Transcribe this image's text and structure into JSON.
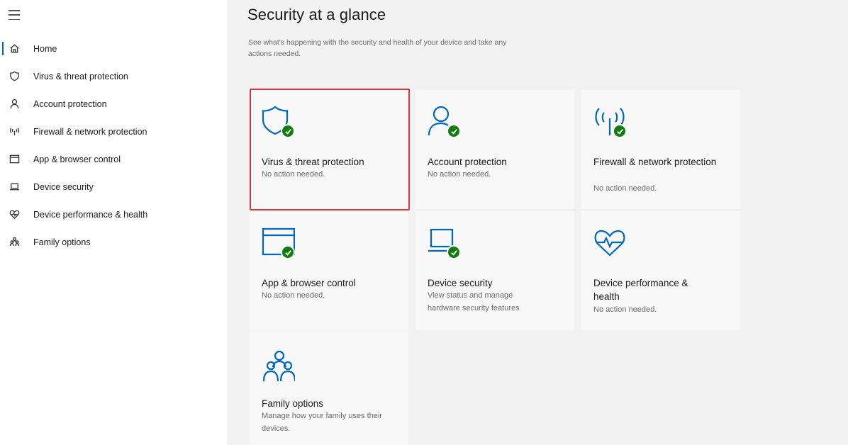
{
  "sidebar": {
    "items": [
      {
        "label": "Home",
        "icon": "home-icon",
        "active": true
      },
      {
        "label": "Virus & threat protection",
        "icon": "shield-icon"
      },
      {
        "label": "Account protection",
        "icon": "person-icon"
      },
      {
        "label": "Firewall & network protection",
        "icon": "wifi-antenna-icon"
      },
      {
        "label": "App & browser control",
        "icon": "browser-window-icon"
      },
      {
        "label": "Device security",
        "icon": "laptop-icon"
      },
      {
        "label": "Device performance & health",
        "icon": "heart-pulse-icon"
      },
      {
        "label": "Family options",
        "icon": "family-icon"
      }
    ]
  },
  "main": {
    "title": "Security at a glance",
    "subtitle": "See what's happening with the security and health of your device and take any actions needed.",
    "tiles": [
      {
        "title": "Virus & threat protection",
        "status": "No action needed.",
        "icon": "shield-icon",
        "selected": true
      },
      {
        "title": "Account protection",
        "status": "No action needed.",
        "icon": "person-icon"
      },
      {
        "title": "Firewall & network protection",
        "status": "No action needed.",
        "icon": "wifi-antenna-icon"
      },
      {
        "title": "App & browser control",
        "status": "No action needed.",
        "icon": "browser-window-icon"
      },
      {
        "title": "Device security",
        "status": "View status and manage hardware security features",
        "icon": "laptop-icon"
      },
      {
        "title": "Device performance & health",
        "status": "No action needed.",
        "icon": "heart-pulse-icon"
      },
      {
        "title": "Family options",
        "status": "Manage how your family uses their devices.",
        "icon": "family-icon"
      }
    ]
  },
  "colors": {
    "accent": "#0067c0",
    "ok_green": "#107c10",
    "highlight_red": "#e0353b"
  }
}
